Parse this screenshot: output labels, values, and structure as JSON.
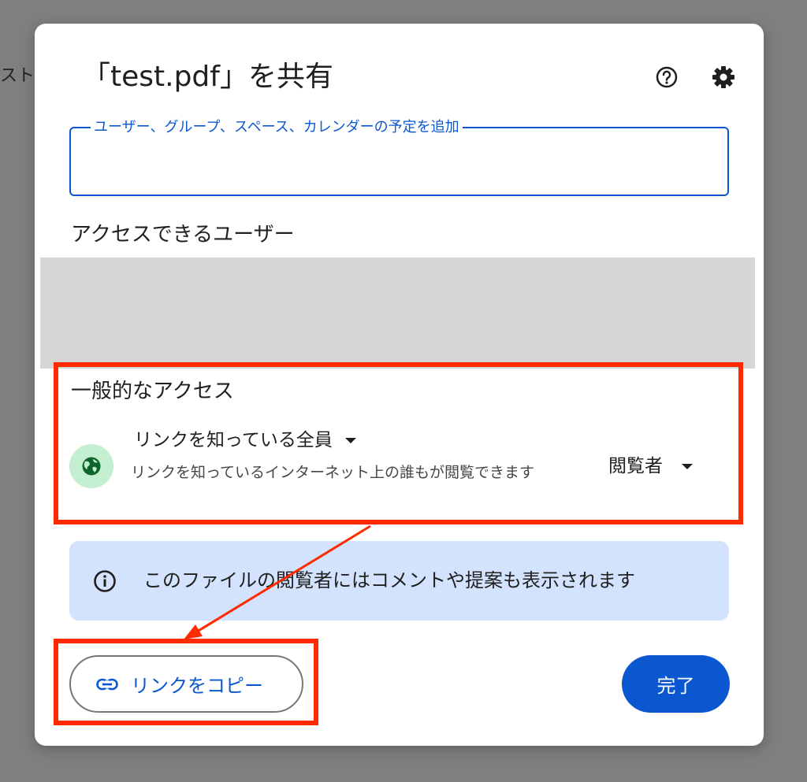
{
  "background": {
    "text": "スト"
  },
  "dialog": {
    "title": "「test.pdf」を共有",
    "help_icon": "help-circle-icon",
    "settings_icon": "gear-icon",
    "add_people": {
      "placeholder": "ユーザー、グループ、スペース、カレンダーの予定を追加",
      "value": ""
    },
    "people_section_title": "アクセスできるユーザー",
    "general_access": {
      "title": "一般的なアクセス",
      "icon": "globe-icon",
      "access_option": "リンクを知っている全員",
      "description": "リンクを知っているインターネット上の誰もが閲覧できます",
      "role": "閲覧者"
    },
    "info_banner": {
      "icon": "info-icon",
      "text": "このファイルの閲覧者にはコメントや提案も表示されます"
    },
    "copy_link_button": {
      "icon": "link-icon",
      "label": "リンクをコピー"
    },
    "done_button": {
      "label": "完了"
    }
  },
  "colors": {
    "accent": "#0b57d0",
    "annotation": "#ff2a00",
    "info_bg": "#d3e3fd",
    "globe_bg": "#c4eed0",
    "globe_fg": "#0d652d"
  }
}
